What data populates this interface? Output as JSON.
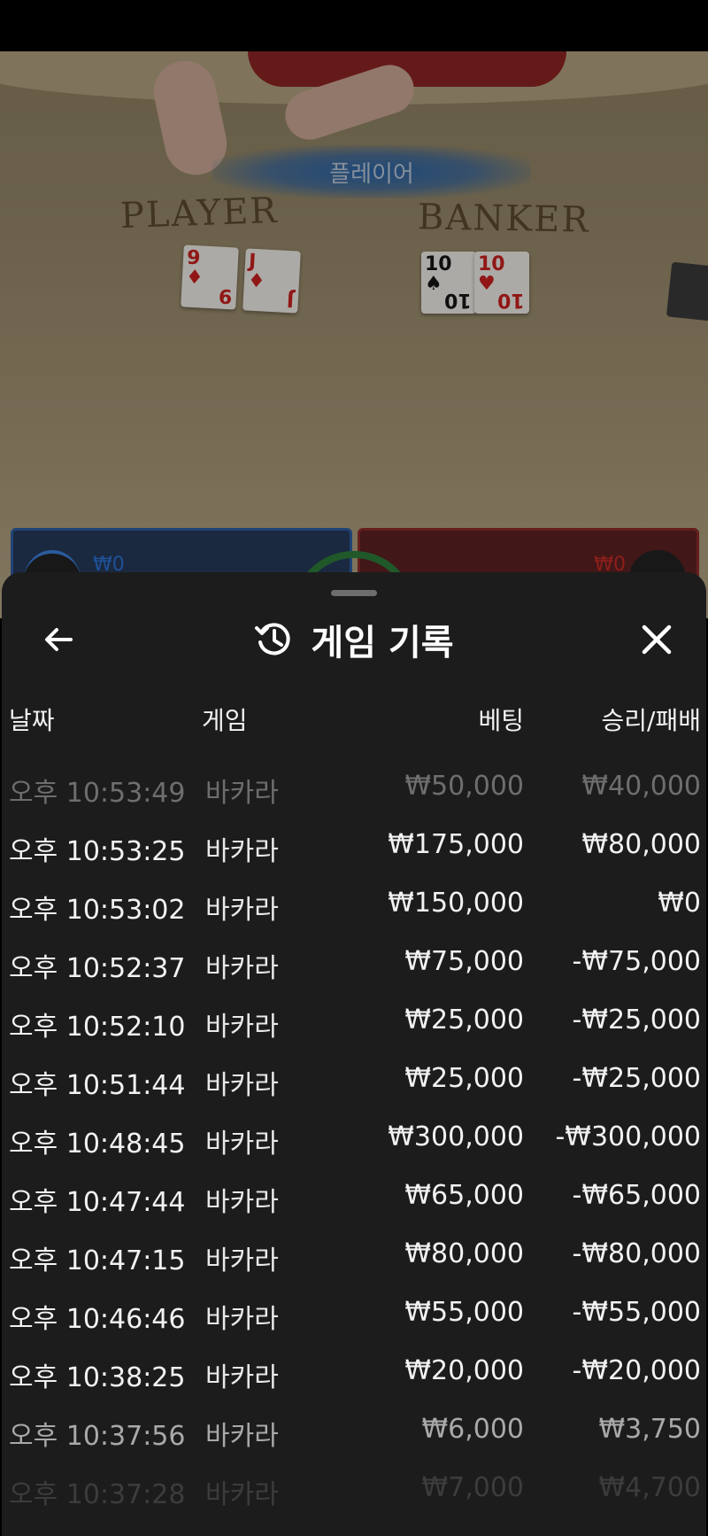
{
  "game_view": {
    "result_banner": "플레이어",
    "player_label": "PLAYER",
    "banker_label": "BANKER",
    "player_cards": [
      {
        "rank": "9",
        "suit": "diamond",
        "color": "#c8201f"
      },
      {
        "rank": "J",
        "suit": "diamond",
        "color": "#c8201f"
      }
    ],
    "banker_cards": [
      {
        "rank": "10",
        "suit": "spade",
        "color": "#151515"
      },
      {
        "rank": "10",
        "suit": "heart",
        "color": "#c8201f"
      }
    ],
    "player_bet": "₩0",
    "banker_bet": "₩0"
  },
  "sheet": {
    "title": "게임 기록",
    "back_icon": "arrow-left-icon",
    "history_icon": "history-icon",
    "close_icon": "close-icon",
    "columns": {
      "date": "날짜",
      "game": "게임",
      "bet": "베팅",
      "result": "승리/패배"
    },
    "rows": [
      {
        "date": "오후 10:53:49",
        "game": "바카라",
        "bet": "₩50,000",
        "result": "₩40,000"
      },
      {
        "date": "오후 10:53:25",
        "game": "바카라",
        "bet": "₩175,000",
        "result": "₩80,000"
      },
      {
        "date": "오후 10:53:02",
        "game": "바카라",
        "bet": "₩150,000",
        "result": "₩0"
      },
      {
        "date": "오후 10:52:37",
        "game": "바카라",
        "bet": "₩75,000",
        "result": "-₩75,000"
      },
      {
        "date": "오후 10:52:10",
        "game": "바카라",
        "bet": "₩25,000",
        "result": "-₩25,000"
      },
      {
        "date": "오후 10:51:44",
        "game": "바카라",
        "bet": "₩25,000",
        "result": "-₩25,000"
      },
      {
        "date": "오후 10:48:45",
        "game": "바카라",
        "bet": "₩300,000",
        "result": "-₩300,000"
      },
      {
        "date": "오후 10:47:44",
        "game": "바카라",
        "bet": "₩65,000",
        "result": "-₩65,000"
      },
      {
        "date": "오후 10:47:15",
        "game": "바카라",
        "bet": "₩80,000",
        "result": "-₩80,000"
      },
      {
        "date": "오후 10:46:46",
        "game": "바카라",
        "bet": "₩55,000",
        "result": "-₩55,000"
      },
      {
        "date": "오후 10:38:25",
        "game": "바카라",
        "bet": "₩20,000",
        "result": "-₩20,000"
      },
      {
        "date": "오후 10:37:56",
        "game": "바카라",
        "bet": "₩6,000",
        "result": "₩3,750"
      },
      {
        "date": "오후 10:37:28",
        "game": "바카라",
        "bet": "₩7,000",
        "result": "₩4,700"
      }
    ]
  },
  "colors": {
    "sheet_bg": "#1c1c1c",
    "text": "#f2f2f2",
    "player_blue": "#2e5ea4",
    "banker_red": "#8c2a2a"
  }
}
